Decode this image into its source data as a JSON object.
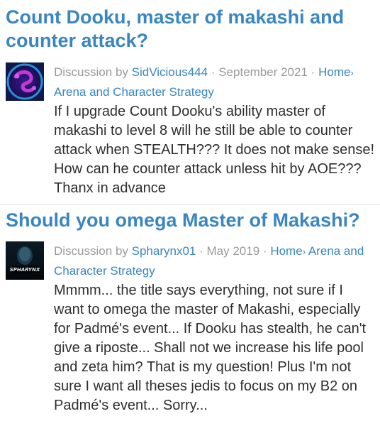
{
  "threads": [
    {
      "title": "Count Dooku, master of makashi and counter attack?",
      "avatar": "purple-swirl-avatar",
      "meta": {
        "type": "Discussion",
        "by": "by",
        "author": "SidVicious444",
        "separator": "·",
        "date": "September 2021",
        "category_root": "Home",
        "chevron": "›",
        "category": "Arena and Character Strategy"
      },
      "body": "If I upgrade Count Dooku's ability master of makashi to level 8 will he still be able to counter attack when STEALTH??? It does not make sense! How can he counter attack unless hit by AOE??? Thanx in advance"
    },
    {
      "title": "Should you omega Master of Makashi?",
      "avatar": "spharynx-avatar",
      "avatar_text": "SPHARYNX",
      "meta": {
        "type": "Discussion",
        "by": "by",
        "author": "Spharynx01",
        "separator": "·",
        "date": "May 2019",
        "category_root": "Home",
        "chevron": "›",
        "category": "Arena and Character Strategy"
      },
      "body": "Mmmm... the title says everything, not sure if I want to omega the master of Makashi, especially for Padmé's event... If Dooku has stealth, he can't give a riposte... Shall not we increase his life pool and zeta him? That is my question! Plus I'm not sure I want all theses jedis to focus on my B2 on Padmé's event... Sorry..."
    }
  ],
  "colors": {
    "link": "#3a86c0",
    "meta_gray": "#9a9a9a",
    "body_text": "#2e2e2e",
    "divider": "#e3e3e3"
  }
}
